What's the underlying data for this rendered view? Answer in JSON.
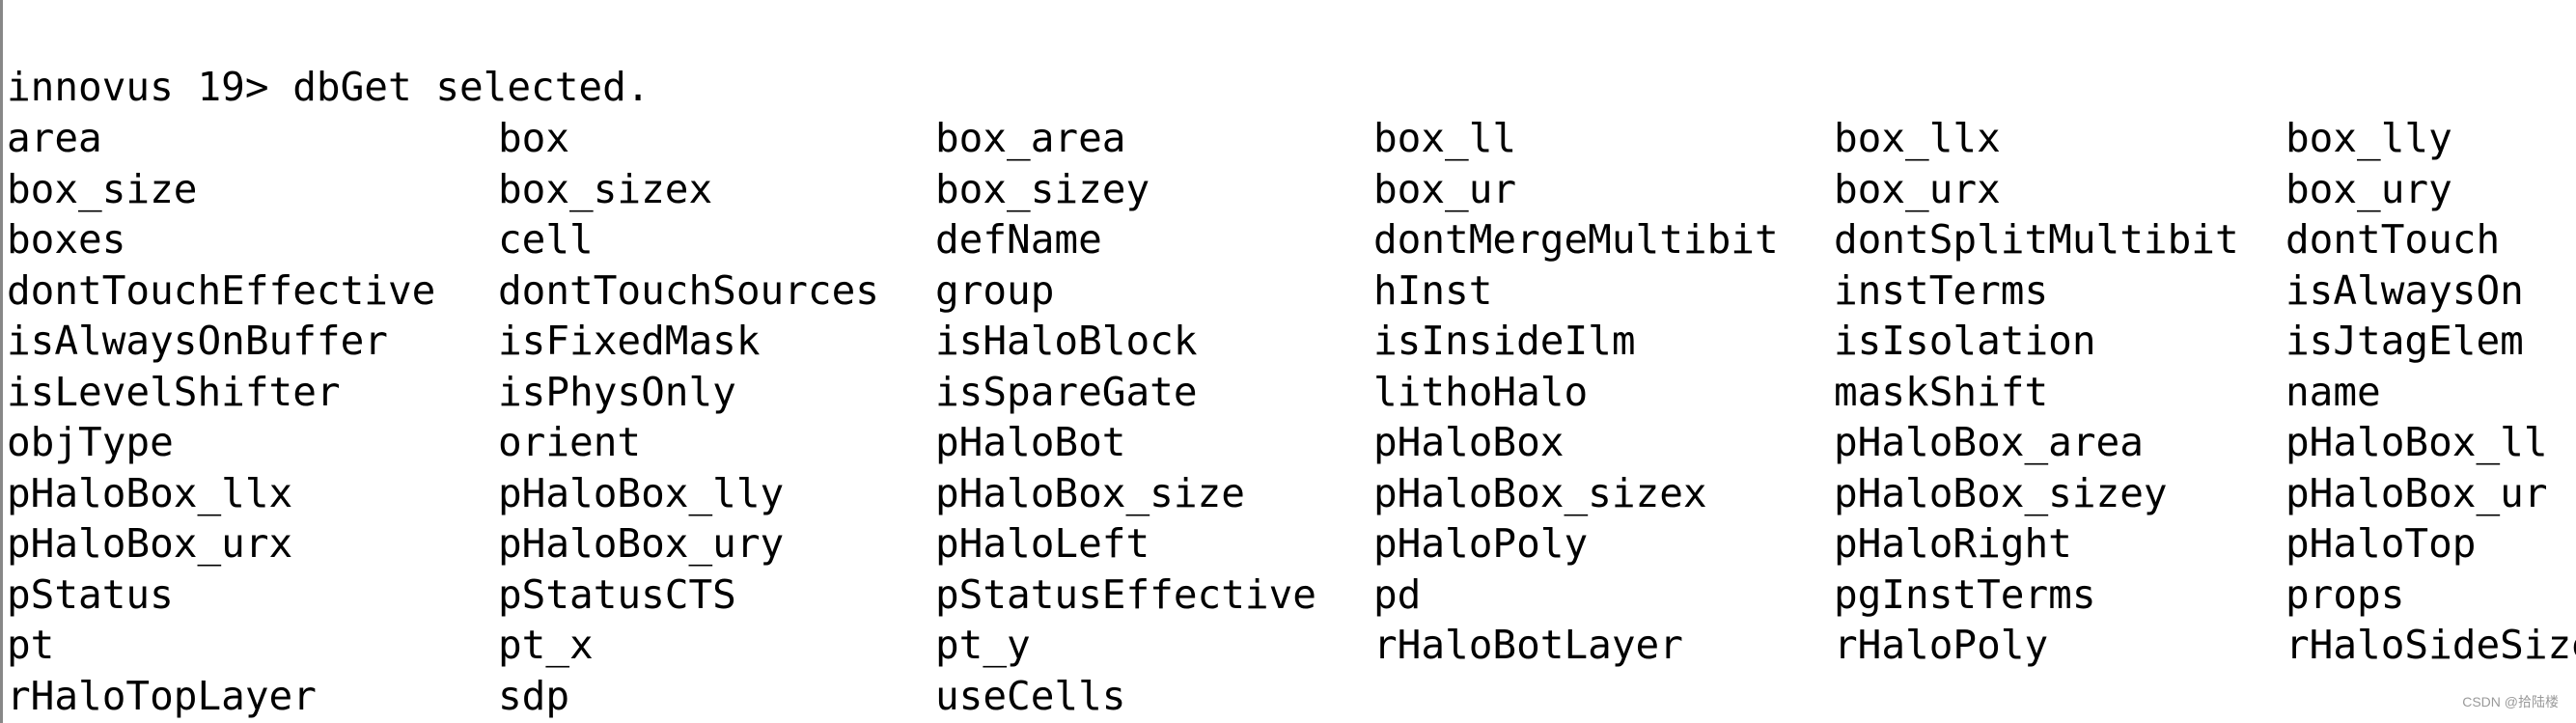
{
  "terminal": {
    "prompt": "innovus 19> dbGet selected.",
    "attributes": [
      "area",
      "box",
      "box_area",
      "box_ll",
      "box_llx",
      "box_lly",
      "box_size",
      "box_sizex",
      "box_sizey",
      "box_ur",
      "box_urx",
      "box_ury",
      "boxes",
      "cell",
      "defName",
      "dontMergeMultibit",
      "dontSplitMultibit",
      "dontTouch",
      "dontTouchEffective",
      "dontTouchSources",
      "group",
      "hInst",
      "instTerms",
      "isAlwaysOn",
      "isAlwaysOnBuffer",
      "isFixedMask",
      "isHaloBlock",
      "isInsideIlm",
      "isIsolation",
      "isJtagElem",
      "isLevelShifter",
      "isPhysOnly",
      "isSpareGate",
      "lithoHalo",
      "maskShift",
      "name",
      "objType",
      "orient",
      "pHaloBot",
      "pHaloBox",
      "pHaloBox_area",
      "pHaloBox_ll",
      "pHaloBox_llx",
      "pHaloBox_lly",
      "pHaloBox_size",
      "pHaloBox_sizex",
      "pHaloBox_sizey",
      "pHaloBox_ur",
      "pHaloBox_urx",
      "pHaloBox_ury",
      "pHaloLeft",
      "pHaloPoly",
      "pHaloRight",
      "pHaloTop",
      "pStatus",
      "pStatusCTS",
      "pStatusEffective",
      "pd",
      "pgInstTerms",
      "props",
      "pt",
      "pt_x",
      "pt_y",
      "rHaloBotLayer",
      "rHaloPoly",
      "rHaloSideSize",
      "rHaloTopLayer",
      "sdp",
      "useCells"
    ]
  },
  "watermark": "CSDN @拾陆楼"
}
